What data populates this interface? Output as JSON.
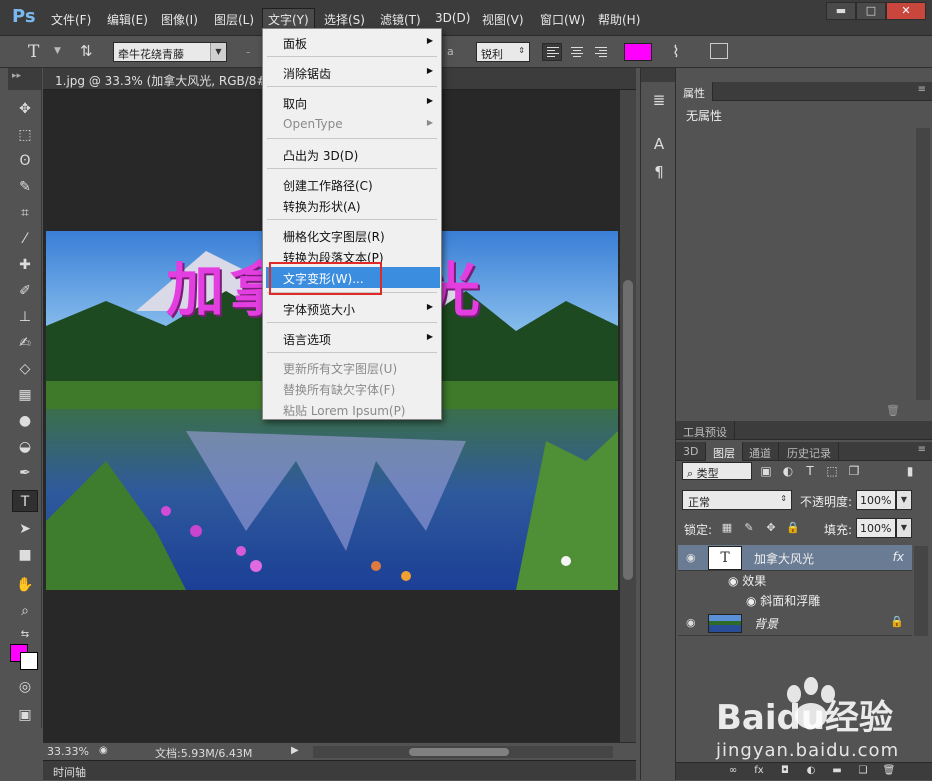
{
  "app": {
    "logo": "Ps",
    "menus": [
      "文件(F)",
      "编辑(E)",
      "图像(I)",
      "图层(L)",
      "文字(Y)",
      "选择(S)",
      "滤镜(T)",
      "3D(D)",
      "视图(V)",
      "窗口(W)",
      "帮助(H)"
    ],
    "active_menu": "文字(Y)",
    "window_buttons": [
      "▬",
      "□",
      "✕"
    ]
  },
  "options_bar": {
    "tool_glyph": "T",
    "font_family": "牵牛花绕青藤",
    "dash": "-",
    "aa_label": "a",
    "antialias": "锐利",
    "text_color": "#ff00ff"
  },
  "document": {
    "tab_title": "1.jpg @ 33.3% (加拿大风光, RGB/8#) *",
    "canvas_text": "加拿大风光",
    "zoom": "33.33%",
    "doc_size": "文档:5.93M/6.43M",
    "timeline_label": "时间轴"
  },
  "type_menu": {
    "items": [
      {
        "label": "面板",
        "submenu": true,
        "disabled": false
      },
      {
        "label": "消除锯齿",
        "submenu": true,
        "disabled": false
      },
      {
        "label": "取向",
        "submenu": true,
        "disabled": false
      },
      {
        "label": "OpenType",
        "submenu": true,
        "disabled": true
      },
      {
        "label": "凸出为 3D(D)",
        "submenu": false,
        "disabled": false
      },
      {
        "label": "创建工作路径(C)",
        "submenu": false,
        "disabled": false
      },
      {
        "label": "转换为形状(A)",
        "submenu": false,
        "disabled": false
      },
      {
        "label": "栅格化文字图层(R)",
        "submenu": false,
        "disabled": false
      },
      {
        "label": "转换为段落文本(P)",
        "submenu": false,
        "disabled": false
      },
      {
        "label": "文字变形(W)...",
        "submenu": false,
        "disabled": false,
        "highlighted": true
      },
      {
        "label": "字体预览大小",
        "submenu": true,
        "disabled": false
      },
      {
        "label": "语言选项",
        "submenu": true,
        "disabled": false
      },
      {
        "label": "更新所有文字图层(U)",
        "submenu": false,
        "disabled": true
      },
      {
        "label": "替换所有缺欠字体(F)",
        "submenu": false,
        "disabled": true
      },
      {
        "label": "粘贴 Lorem Ipsum(P)",
        "submenu": false,
        "disabled": true
      }
    ]
  },
  "properties_panel": {
    "tab": "属性",
    "empty_text": "无属性"
  },
  "tool_presets_panel": {
    "tab": "工具预设"
  },
  "layers_panel": {
    "tabs": [
      "3D",
      "图层",
      "通道",
      "历史记录"
    ],
    "active_tab": "图层",
    "filter_kind": "类型",
    "blend_mode": "正常",
    "opacity_label": "不透明度:",
    "opacity": "100%",
    "lock_label": "锁定:",
    "fill_label": "填充:",
    "fill": "100%",
    "layers": [
      {
        "name": "加拿大风光",
        "type": "text",
        "fx": "fx",
        "effects_label": "效果",
        "effects": [
          "斜面和浮雕"
        ]
      },
      {
        "name": "背景",
        "type": "image",
        "locked": true
      }
    ]
  },
  "watermark": {
    "brand": "Baidu经验",
    "url": "jingyan.baidu.com"
  }
}
